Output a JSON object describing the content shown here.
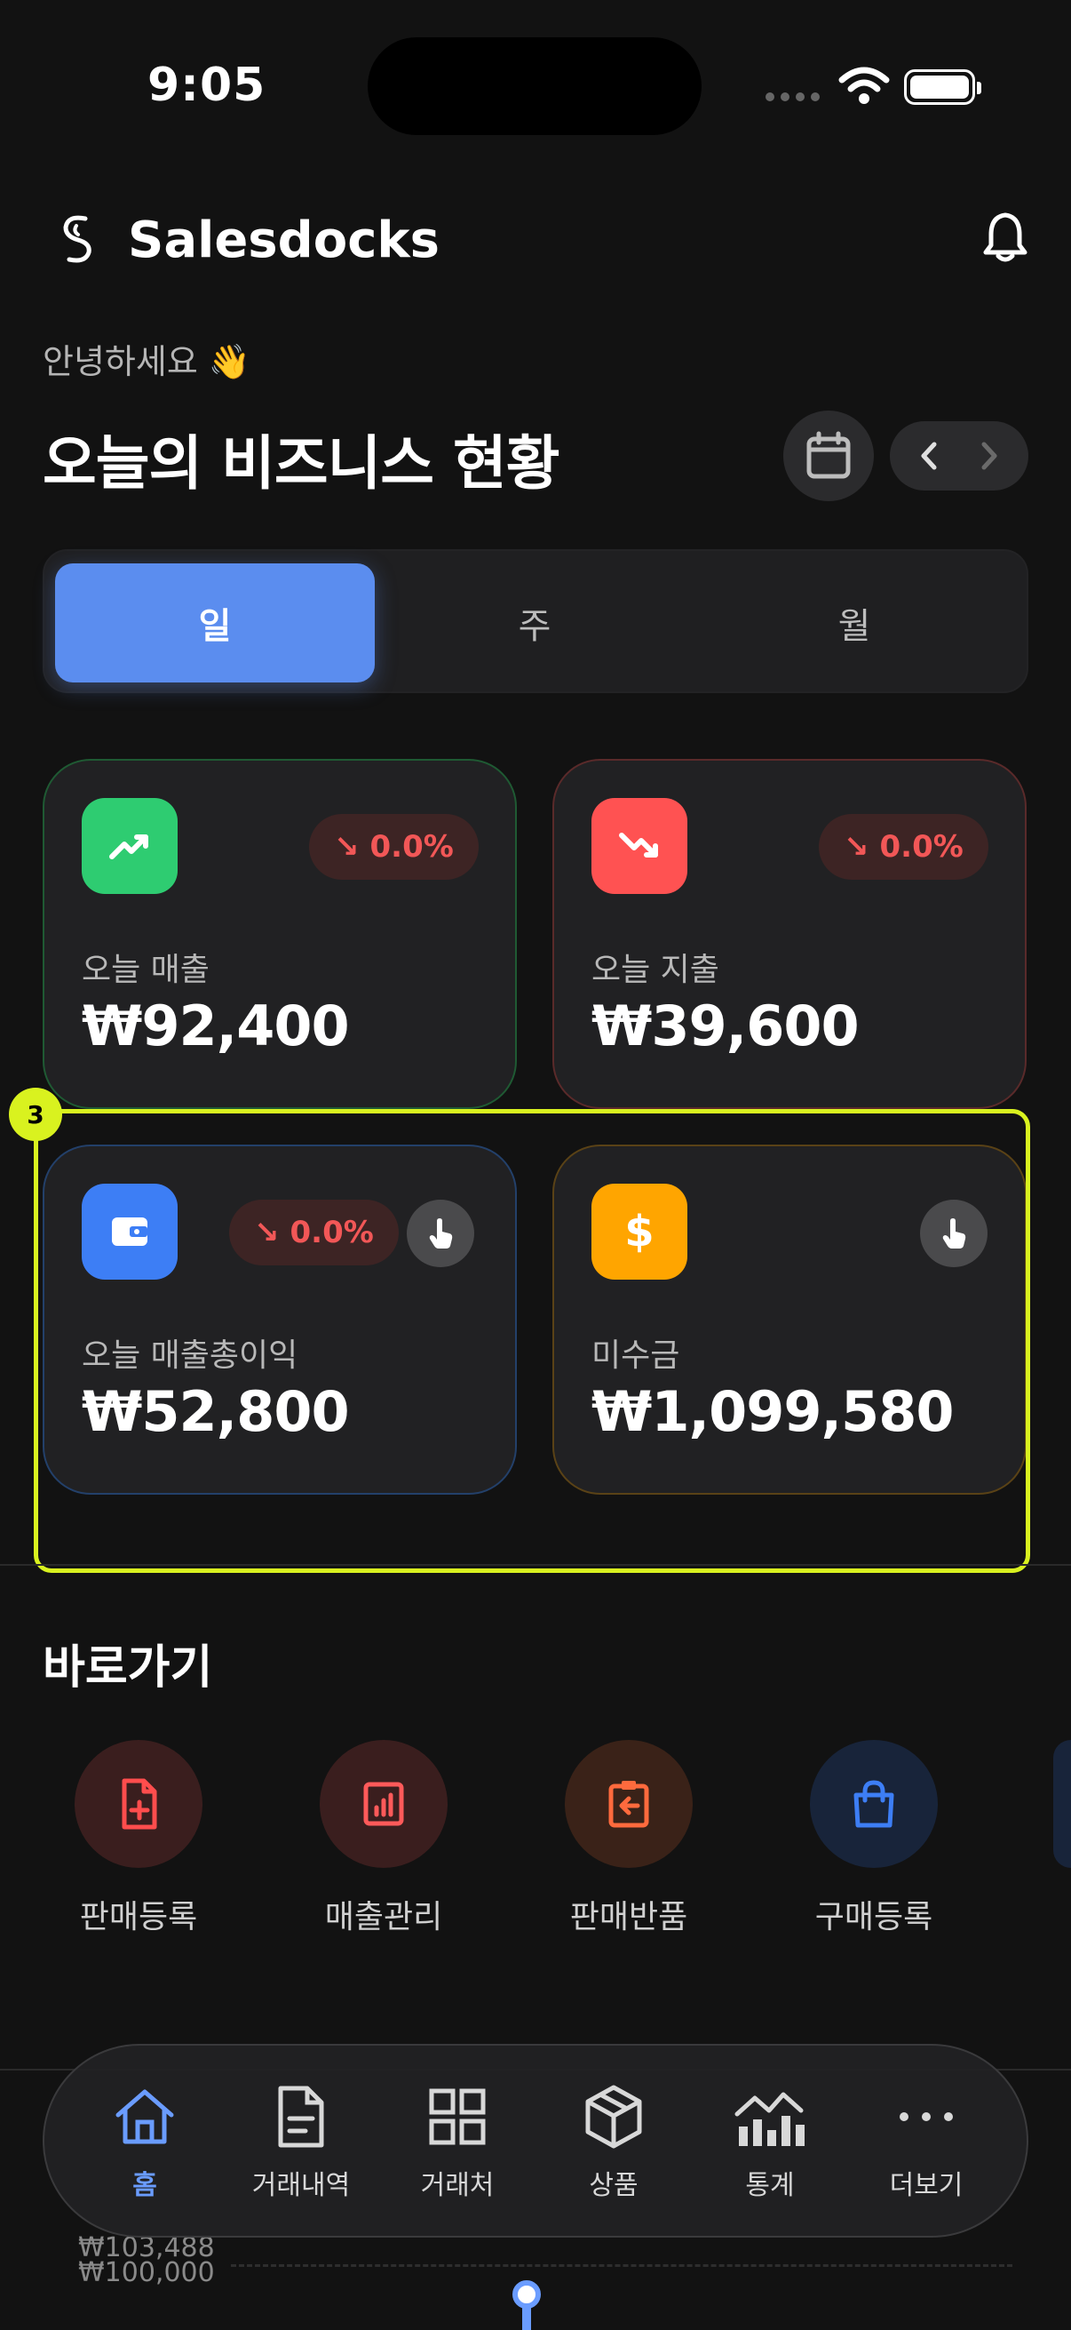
{
  "status_bar": {
    "time": "9:05"
  },
  "header": {
    "app_name": "Salesdocks"
  },
  "greeting": "안녕하세요 👋",
  "title": "오늘의 비즈니스 현황",
  "period_tabs": [
    {
      "label": "일",
      "active": true
    },
    {
      "label": "주",
      "active": false
    },
    {
      "label": "월",
      "active": false
    }
  ],
  "cards": [
    {
      "label": "오늘 매출",
      "value": "₩92,400",
      "change": "0.0%",
      "icon": "trending-up-icon",
      "color": "#2ecc71"
    },
    {
      "label": "오늘 지출",
      "value": "₩39,600",
      "change": "0.0%",
      "icon": "trending-down-icon",
      "color": "#ff5252"
    },
    {
      "label": "오늘 매출총이익",
      "value": "₩52,800",
      "change": "0.0%",
      "icon": "wallet-icon",
      "color": "#3d7ef5"
    },
    {
      "label": "미수금",
      "value": "₩1,099,580",
      "icon": "dollar-icon",
      "color": "#ffa500"
    }
  ],
  "highlight_badge": "3",
  "shortcuts": {
    "title": "바로가기",
    "items": [
      {
        "label": "판매등록",
        "icon": "file-plus-icon",
        "color": "#ff4d4d"
      },
      {
        "label": "매출관리",
        "icon": "chart-file-icon",
        "color": "#ff5a5a"
      },
      {
        "label": "판매반품",
        "icon": "clipboard-return-icon",
        "color": "#ff6a3d"
      },
      {
        "label": "구매등록",
        "icon": "shopping-bag-icon",
        "color": "#3d7ef5"
      }
    ]
  },
  "tab_bar": [
    {
      "label": "홈",
      "icon": "home-icon",
      "active": true
    },
    {
      "label": "거래내역",
      "icon": "document-icon",
      "active": false
    },
    {
      "label": "거래처",
      "icon": "grid-icon",
      "active": false
    },
    {
      "label": "상품",
      "icon": "box-icon",
      "active": false
    },
    {
      "label": "통계",
      "icon": "stats-icon",
      "active": false
    },
    {
      "label": "더보기",
      "icon": "more-icon",
      "active": false
    }
  ],
  "background_chart": {
    "label_1": "₩103,488",
    "label_2": "₩100,000"
  },
  "colors": {
    "accent": "#5b8def",
    "highlight": "#d9f21f",
    "negative": "#f25757"
  }
}
